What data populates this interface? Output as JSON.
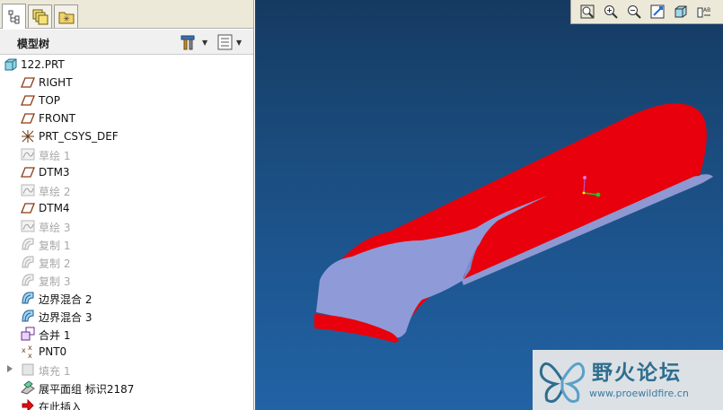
{
  "model_tree": {
    "title": "模型树",
    "tabs": [
      "model-tree",
      "layers",
      "favorites"
    ],
    "items": [
      {
        "label": "122.PRT",
        "icon": "part-icon",
        "disabled": false
      },
      {
        "label": "RIGHT",
        "icon": "datum-plane-icon",
        "disabled": false
      },
      {
        "label": "TOP",
        "icon": "datum-plane-icon",
        "disabled": false
      },
      {
        "label": "FRONT",
        "icon": "datum-plane-icon",
        "disabled": false
      },
      {
        "label": "PRT_CSYS_DEF",
        "icon": "csys-icon",
        "disabled": false
      },
      {
        "label": "草绘 1",
        "icon": "sketch-icon",
        "disabled": true
      },
      {
        "label": "DTM3",
        "icon": "datum-plane-icon",
        "disabled": false
      },
      {
        "label": "草绘 2",
        "icon": "sketch-icon",
        "disabled": true
      },
      {
        "label": "DTM4",
        "icon": "datum-plane-icon",
        "disabled": false
      },
      {
        "label": "草绘 3",
        "icon": "sketch-icon",
        "disabled": true
      },
      {
        "label": "复制 1",
        "icon": "copy-icon",
        "disabled": true
      },
      {
        "label": "复制 2",
        "icon": "copy-icon",
        "disabled": true
      },
      {
        "label": "复制 3",
        "icon": "copy-icon",
        "disabled": true
      },
      {
        "label": "边界混合 2",
        "icon": "boundary-blend-icon",
        "disabled": false
      },
      {
        "label": "边界混合 3",
        "icon": "boundary-blend-icon",
        "disabled": false
      },
      {
        "label": "合并 1",
        "icon": "merge-icon",
        "disabled": false
      },
      {
        "label": "PNT0",
        "icon": "datum-point-icon",
        "disabled": false
      },
      {
        "label": "填充 1",
        "icon": "fill-icon",
        "disabled": true
      },
      {
        "label": "展平面组 标识2187",
        "icon": "flatten-quilt-icon",
        "disabled": false
      },
      {
        "label": "在此插入",
        "icon": "insert-here-arrow-icon",
        "disabled": false
      }
    ]
  },
  "view_toolbar": {
    "buttons": [
      "zoom-fit-icon",
      "zoom-in-icon",
      "zoom-out-icon",
      "repaint-icon",
      "view-orientation-icon",
      "saved-views-icon"
    ]
  },
  "watermark": {
    "title": "野火论坛",
    "url": "www.proewildfire.cn"
  },
  "colors": {
    "viewport_top": "#153a62",
    "viewport_bottom": "#2263a5",
    "surface_red": "#e8000c",
    "surface_blue": "#8f9bd8"
  }
}
